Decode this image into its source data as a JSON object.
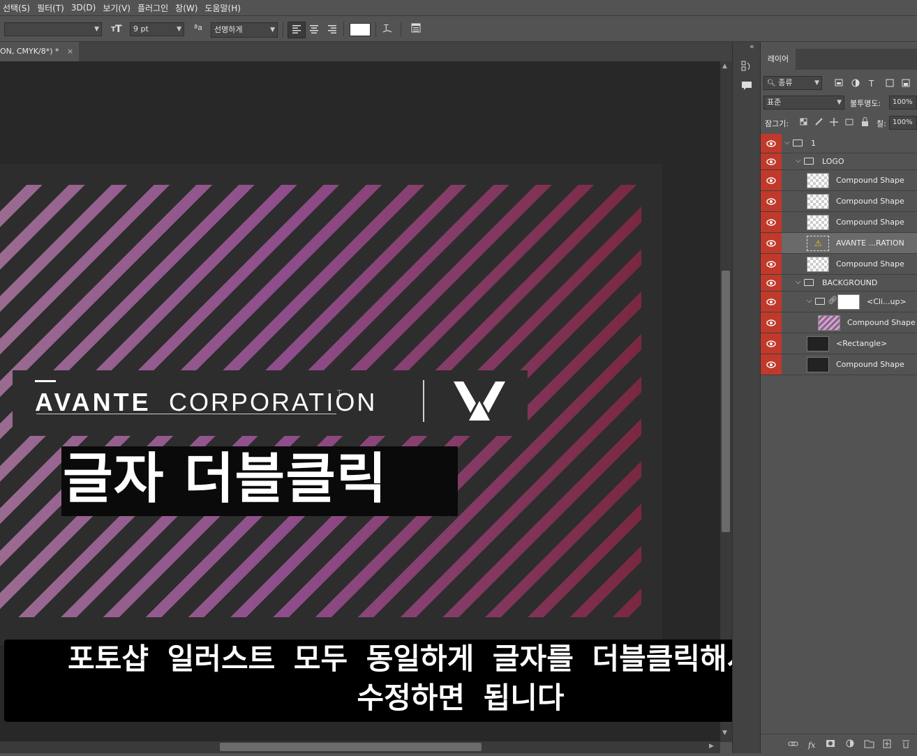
{
  "menu": [
    "선택(S)",
    "필터(T)",
    "3D(D)",
    "보기(V)",
    "플러그인",
    "창(W)",
    "도움말(H)"
  ],
  "options": {
    "font_size": "9 pt",
    "antialias": "선명하게",
    "text_color": "#ffffff"
  },
  "document_tab": {
    "title": "ON, CMYK/8*) *",
    "close": "×"
  },
  "artboard": {
    "brand_bold": "AVANTE",
    "brand_light": "CORPORATION",
    "logo_mark": "VX",
    "headline": "글자 더블클릭",
    "stripe_start": "#9a6b91",
    "stripe_mid": "#8e4d8b",
    "stripe_end": "#7a2840"
  },
  "subtitle": {
    "line1": "포토샵 일러스트 모두 동일하게 글자를 더블클릭해서 글자를",
    "line2": "수정하면 됩니다"
  },
  "layers_panel": {
    "collapse_glyph": "«",
    "tab_label": "레이어",
    "filter_label": "종류",
    "blend_mode": "표준",
    "opacity_label": "불투명도:",
    "opacity_value": "100%",
    "lock_label": "잠그기:",
    "fill_label": "칠:",
    "fill_value": "100%",
    "layers": [
      {
        "name": "1"
      },
      {
        "name": "LOGO"
      },
      {
        "name": "Compound Shape"
      },
      {
        "name": "Compound Shape"
      },
      {
        "name": "Compound Shape"
      },
      {
        "name": "AVANTE ...RATION"
      },
      {
        "name": "Compound Shape"
      },
      {
        "name": "BACKGROUND"
      },
      {
        "name": "<Cli...up>"
      },
      {
        "name": "Compound Shape"
      },
      {
        "name": "<Rectangle>"
      },
      {
        "name": "Compound Shape"
      }
    ]
  },
  "colors": {
    "ui_bg": "#535353",
    "visibility": "#c0392b"
  }
}
